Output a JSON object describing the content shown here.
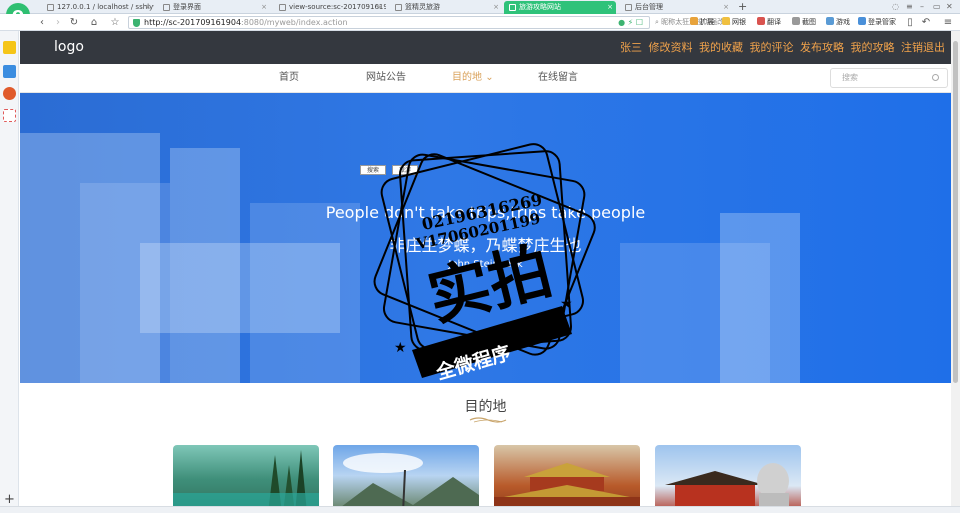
{
  "browser": {
    "tabs": [
      {
        "label": "127.0.0.1 / localhost / sshlyw",
        "active": false
      },
      {
        "label": "登录界面",
        "active": false
      },
      {
        "label": "view-source:sc-201709161904",
        "active": false
      },
      {
        "label": "篮精灵旅游",
        "active": false
      },
      {
        "label": "旅游攻略网站",
        "active": true
      },
      {
        "label": "后台管理",
        "active": false
      }
    ],
    "url_host": "http://sc-201709161904",
    "url_rest": ":8080/myweb/index.action",
    "search_hint": "昵称太狂遭投诉强改名",
    "extensions": [
      "扩展",
      "网银",
      "翻译",
      "截图",
      "游戏",
      "登录管家"
    ]
  },
  "site": {
    "logo": "logo",
    "user": {
      "name": "张三",
      "links": [
        "修改资料",
        "我的收藏",
        "我的评论",
        "发布攻略",
        "我的攻略",
        "注销退出"
      ]
    },
    "nav": [
      "首页",
      "网站公告",
      "目的地",
      "在线留言"
    ],
    "active_nav": "目的地",
    "nav_caret": "⌄",
    "search_placeholder": "搜索"
  },
  "hero": {
    "buttons": [
      "搜索",
      "旅游"
    ],
    "quote_en": "People don't take trips,trips take people",
    "quote_cn": "非庄生梦蝶，乃蝶梦庄生也",
    "author": "John Steinbeck"
  },
  "watermark": {
    "digits1": "02196316269",
    "digits2": "V17060201199",
    "big_text": "实拍",
    "ribbon_text": "全微程序"
  },
  "section": {
    "title": "目的地"
  },
  "colors": {
    "topbar": "#34383f",
    "accent": "#d9a15a",
    "user_links": "#f0a24b",
    "hero_blue": "#2f78e6",
    "browser_green": "#2fc27a"
  }
}
